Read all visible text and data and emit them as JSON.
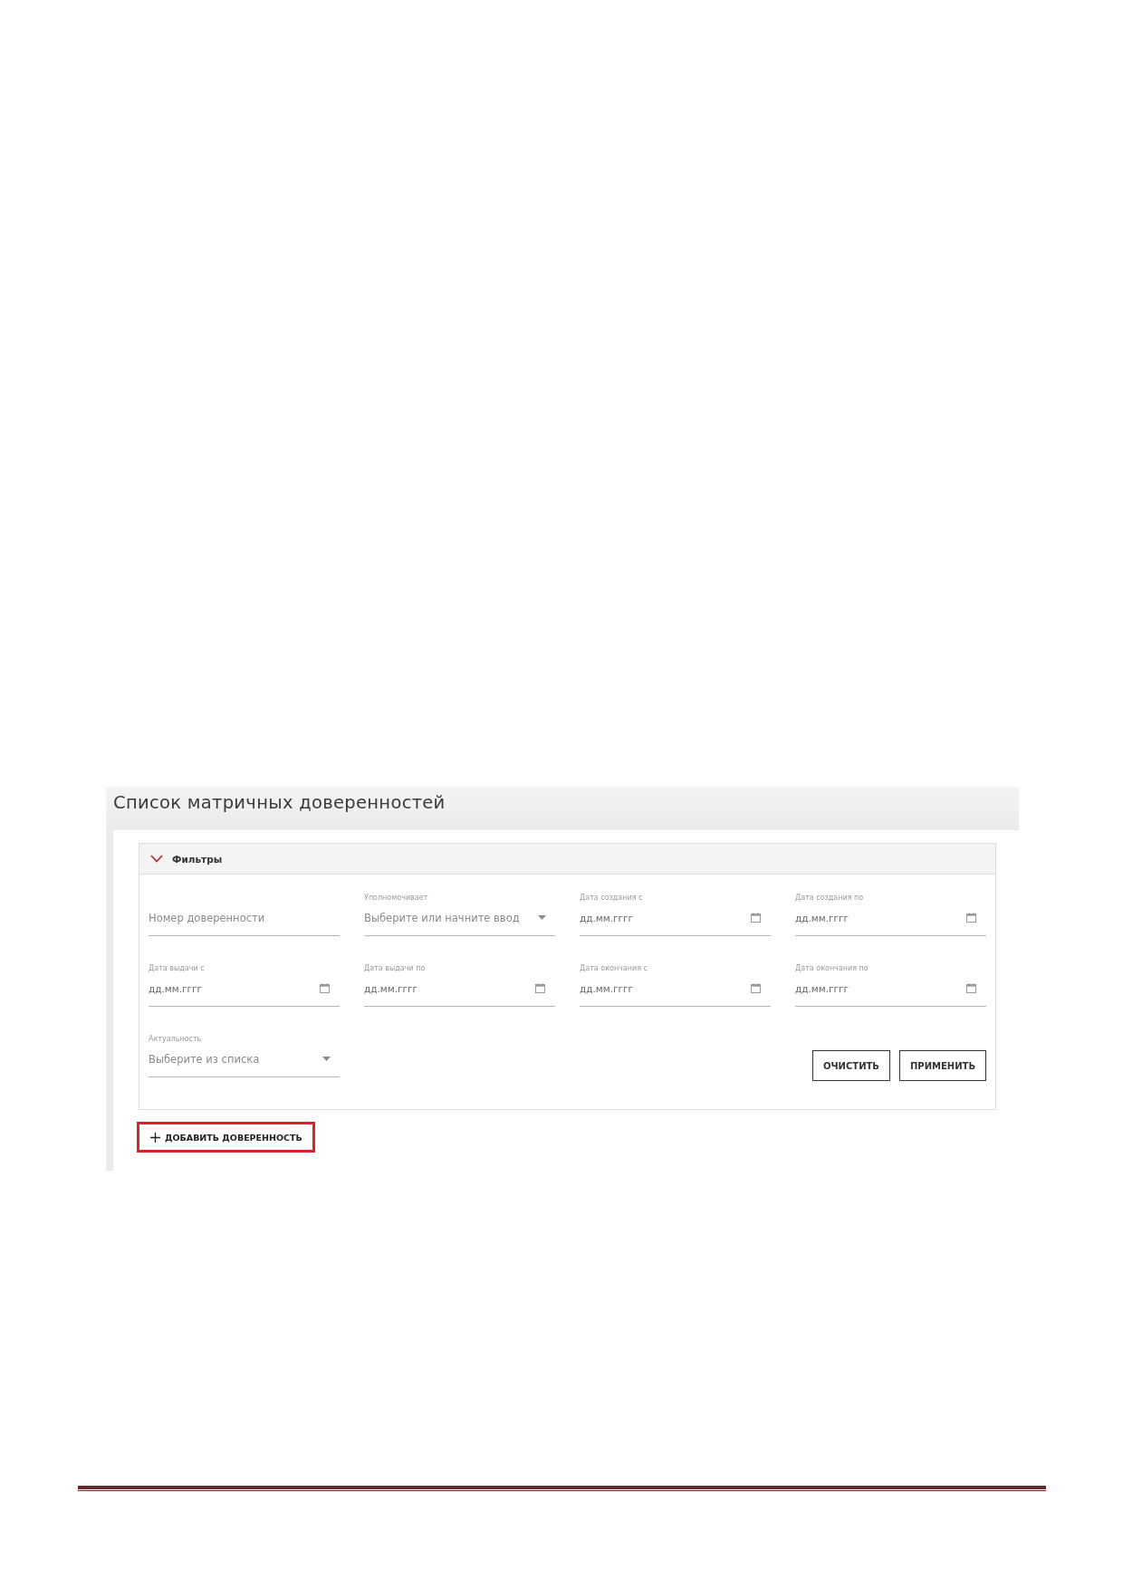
{
  "page_title": "Список матричных доверенностей",
  "filters": {
    "title": "Фильтры",
    "expanded": true,
    "fields": [
      {
        "kind": "text",
        "placeholder": "Номер доверенности"
      },
      {
        "kind": "select",
        "label": "Уполномочивает",
        "placeholder": "Выберите или начните ввод"
      },
      {
        "kind": "date",
        "label": "Дата создания с",
        "placeholder": "дд.мм.гггг"
      },
      {
        "kind": "date",
        "label": "Дата создания по",
        "placeholder": "дд.мм.гггг"
      },
      {
        "kind": "date",
        "label": "Дата выдачи с",
        "placeholder": "дд.мм.гггг"
      },
      {
        "kind": "date",
        "label": "Дата выдачи по",
        "placeholder": "дд.мм.гггг"
      },
      {
        "kind": "date",
        "label": "Дата окончания с",
        "placeholder": "дд.мм.гггг"
      },
      {
        "kind": "date",
        "label": "Дата окончания по",
        "placeholder": "дд.мм.гггг"
      },
      {
        "kind": "select",
        "label": "Актуальность",
        "placeholder": "Выберите из списка"
      }
    ],
    "buttons": [
      "ОЧИСТИТЬ",
      "ПРИМЕНИТЬ"
    ]
  },
  "add_button": {
    "label": "ДОБАВИТЬ ДОВЕРЕННОСТЬ",
    "highlighted": true
  }
}
